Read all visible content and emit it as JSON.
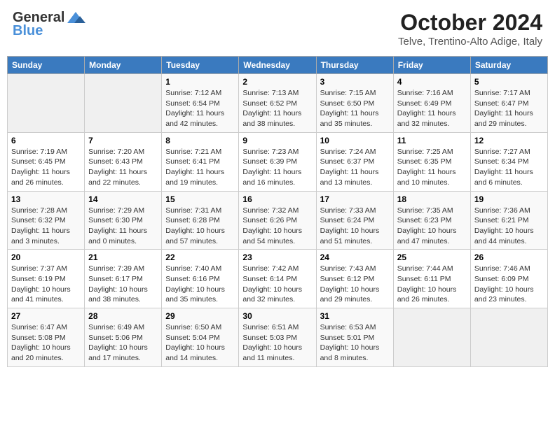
{
  "header": {
    "logo_general": "General",
    "logo_blue": "Blue",
    "month_title": "October 2024",
    "location": "Telve, Trentino-Alto Adige, Italy"
  },
  "days_of_week": [
    "Sunday",
    "Monday",
    "Tuesday",
    "Wednesday",
    "Thursday",
    "Friday",
    "Saturday"
  ],
  "weeks": [
    [
      {
        "day": "",
        "sunrise": "",
        "sunset": "",
        "daylight": "",
        "empty": true
      },
      {
        "day": "",
        "sunrise": "",
        "sunset": "",
        "daylight": "",
        "empty": true
      },
      {
        "day": "1",
        "sunrise": "Sunrise: 7:12 AM",
        "sunset": "Sunset: 6:54 PM",
        "daylight": "Daylight: 11 hours and 42 minutes."
      },
      {
        "day": "2",
        "sunrise": "Sunrise: 7:13 AM",
        "sunset": "Sunset: 6:52 PM",
        "daylight": "Daylight: 11 hours and 38 minutes."
      },
      {
        "day": "3",
        "sunrise": "Sunrise: 7:15 AM",
        "sunset": "Sunset: 6:50 PM",
        "daylight": "Daylight: 11 hours and 35 minutes."
      },
      {
        "day": "4",
        "sunrise": "Sunrise: 7:16 AM",
        "sunset": "Sunset: 6:49 PM",
        "daylight": "Daylight: 11 hours and 32 minutes."
      },
      {
        "day": "5",
        "sunrise": "Sunrise: 7:17 AM",
        "sunset": "Sunset: 6:47 PM",
        "daylight": "Daylight: 11 hours and 29 minutes."
      }
    ],
    [
      {
        "day": "6",
        "sunrise": "Sunrise: 7:19 AM",
        "sunset": "Sunset: 6:45 PM",
        "daylight": "Daylight: 11 hours and 26 minutes."
      },
      {
        "day": "7",
        "sunrise": "Sunrise: 7:20 AM",
        "sunset": "Sunset: 6:43 PM",
        "daylight": "Daylight: 11 hours and 22 minutes."
      },
      {
        "day": "8",
        "sunrise": "Sunrise: 7:21 AM",
        "sunset": "Sunset: 6:41 PM",
        "daylight": "Daylight: 11 hours and 19 minutes."
      },
      {
        "day": "9",
        "sunrise": "Sunrise: 7:23 AM",
        "sunset": "Sunset: 6:39 PM",
        "daylight": "Daylight: 11 hours and 16 minutes."
      },
      {
        "day": "10",
        "sunrise": "Sunrise: 7:24 AM",
        "sunset": "Sunset: 6:37 PM",
        "daylight": "Daylight: 11 hours and 13 minutes."
      },
      {
        "day": "11",
        "sunrise": "Sunrise: 7:25 AM",
        "sunset": "Sunset: 6:35 PM",
        "daylight": "Daylight: 11 hours and 10 minutes."
      },
      {
        "day": "12",
        "sunrise": "Sunrise: 7:27 AM",
        "sunset": "Sunset: 6:34 PM",
        "daylight": "Daylight: 11 hours and 6 minutes."
      }
    ],
    [
      {
        "day": "13",
        "sunrise": "Sunrise: 7:28 AM",
        "sunset": "Sunset: 6:32 PM",
        "daylight": "Daylight: 11 hours and 3 minutes."
      },
      {
        "day": "14",
        "sunrise": "Sunrise: 7:29 AM",
        "sunset": "Sunset: 6:30 PM",
        "daylight": "Daylight: 11 hours and 0 minutes."
      },
      {
        "day": "15",
        "sunrise": "Sunrise: 7:31 AM",
        "sunset": "Sunset: 6:28 PM",
        "daylight": "Daylight: 10 hours and 57 minutes."
      },
      {
        "day": "16",
        "sunrise": "Sunrise: 7:32 AM",
        "sunset": "Sunset: 6:26 PM",
        "daylight": "Daylight: 10 hours and 54 minutes."
      },
      {
        "day": "17",
        "sunrise": "Sunrise: 7:33 AM",
        "sunset": "Sunset: 6:24 PM",
        "daylight": "Daylight: 10 hours and 51 minutes."
      },
      {
        "day": "18",
        "sunrise": "Sunrise: 7:35 AM",
        "sunset": "Sunset: 6:23 PM",
        "daylight": "Daylight: 10 hours and 47 minutes."
      },
      {
        "day": "19",
        "sunrise": "Sunrise: 7:36 AM",
        "sunset": "Sunset: 6:21 PM",
        "daylight": "Daylight: 10 hours and 44 minutes."
      }
    ],
    [
      {
        "day": "20",
        "sunrise": "Sunrise: 7:37 AM",
        "sunset": "Sunset: 6:19 PM",
        "daylight": "Daylight: 10 hours and 41 minutes."
      },
      {
        "day": "21",
        "sunrise": "Sunrise: 7:39 AM",
        "sunset": "Sunset: 6:17 PM",
        "daylight": "Daylight: 10 hours and 38 minutes."
      },
      {
        "day": "22",
        "sunrise": "Sunrise: 7:40 AM",
        "sunset": "Sunset: 6:16 PM",
        "daylight": "Daylight: 10 hours and 35 minutes."
      },
      {
        "day": "23",
        "sunrise": "Sunrise: 7:42 AM",
        "sunset": "Sunset: 6:14 PM",
        "daylight": "Daylight: 10 hours and 32 minutes."
      },
      {
        "day": "24",
        "sunrise": "Sunrise: 7:43 AM",
        "sunset": "Sunset: 6:12 PM",
        "daylight": "Daylight: 10 hours and 29 minutes."
      },
      {
        "day": "25",
        "sunrise": "Sunrise: 7:44 AM",
        "sunset": "Sunset: 6:11 PM",
        "daylight": "Daylight: 10 hours and 26 minutes."
      },
      {
        "day": "26",
        "sunrise": "Sunrise: 7:46 AM",
        "sunset": "Sunset: 6:09 PM",
        "daylight": "Daylight: 10 hours and 23 minutes."
      }
    ],
    [
      {
        "day": "27",
        "sunrise": "Sunrise: 6:47 AM",
        "sunset": "Sunset: 5:08 PM",
        "daylight": "Daylight: 10 hours and 20 minutes."
      },
      {
        "day": "28",
        "sunrise": "Sunrise: 6:49 AM",
        "sunset": "Sunset: 5:06 PM",
        "daylight": "Daylight: 10 hours and 17 minutes."
      },
      {
        "day": "29",
        "sunrise": "Sunrise: 6:50 AM",
        "sunset": "Sunset: 5:04 PM",
        "daylight": "Daylight: 10 hours and 14 minutes."
      },
      {
        "day": "30",
        "sunrise": "Sunrise: 6:51 AM",
        "sunset": "Sunset: 5:03 PM",
        "daylight": "Daylight: 10 hours and 11 minutes."
      },
      {
        "day": "31",
        "sunrise": "Sunrise: 6:53 AM",
        "sunset": "Sunset: 5:01 PM",
        "daylight": "Daylight: 10 hours and 8 minutes."
      },
      {
        "day": "",
        "sunrise": "",
        "sunset": "",
        "daylight": "",
        "empty": true
      },
      {
        "day": "",
        "sunrise": "",
        "sunset": "",
        "daylight": "",
        "empty": true
      }
    ]
  ]
}
